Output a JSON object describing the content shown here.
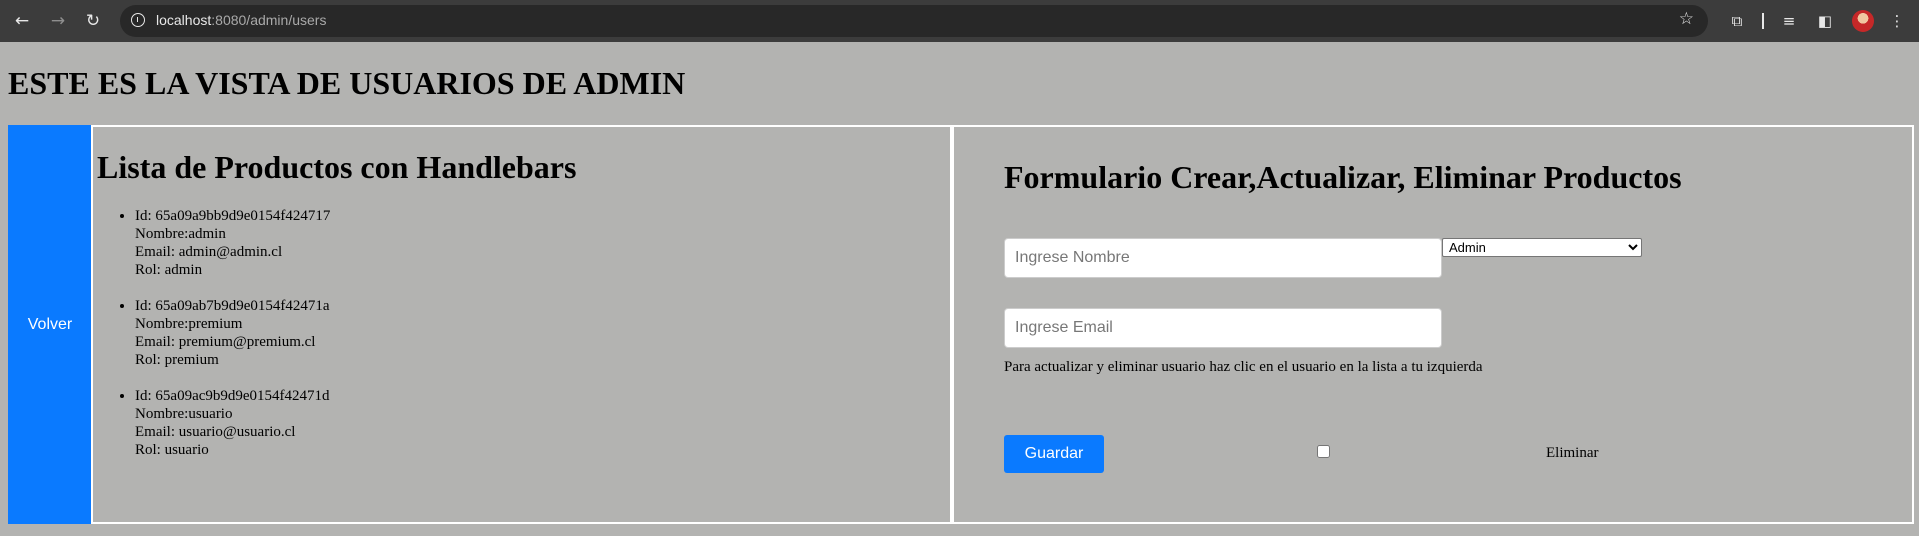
{
  "browser": {
    "url_host": "localhost",
    "url_path": ":8080/admin/users",
    "icons": [
      "back-arrow-icon",
      "forward-arrow-icon",
      "reload-icon",
      "info-icon",
      "star-icon",
      "extensions-icon",
      "reading-list-icon",
      "side-panel-icon",
      "avatar",
      "more-menu-icon"
    ]
  },
  "page": {
    "title": "ESTE ES LA VISTA DE USUARIOS DE ADMIN",
    "volver_label": "Volver"
  },
  "list": {
    "title": "Lista de Productos con Handlebars",
    "users": [
      {
        "id": "Id: 65a09a9bb9d9e0154f424717",
        "nombre": "Nombre:admin",
        "email": "Email: admin@admin.cl",
        "rol": "Rol: admin"
      },
      {
        "id": "Id: 65a09ab7b9d9e0154f42471a",
        "nombre": "Nombre:premium",
        "email": "Email: premium@premium.cl",
        "rol": "Rol: premium"
      },
      {
        "id": "Id: 65a09ac9b9d9e0154f42471d",
        "nombre": "Nombre:usuario",
        "email": "Email: usuario@usuario.cl",
        "rol": "Rol: usuario"
      }
    ]
  },
  "form": {
    "title": "Formulario Crear,Actualizar, Eliminar Productos",
    "nombre_placeholder": "Ingrese Nombre",
    "nombre_value": "",
    "email_placeholder": "Ingrese Email",
    "email_value": "",
    "rol_selected": "Admin",
    "hint": "Para actualizar y eliminar usuario haz clic en el usuario en la lista a tu izquierda",
    "guardar_label": "Guardar",
    "eliminar_checked": false,
    "eliminar_label": "Eliminar"
  },
  "colors": {
    "page_bg": "#b3b3b1",
    "accent": "#0a7aff",
    "chrome_bg": "#3c3c3c"
  }
}
